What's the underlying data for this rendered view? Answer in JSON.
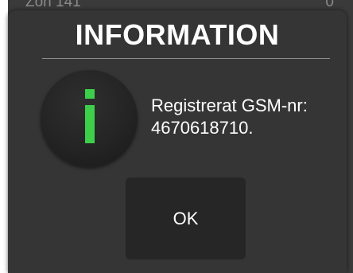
{
  "background": {
    "left_text": "Zon 141",
    "right_text": "0"
  },
  "dialog": {
    "title": "INFORMATION",
    "icon": "info-icon",
    "icon_color": "#3ecf4a",
    "message_line1": "Registrerat GSM-nr:",
    "message_line2": "4670618710.",
    "ok_label": "OK"
  }
}
